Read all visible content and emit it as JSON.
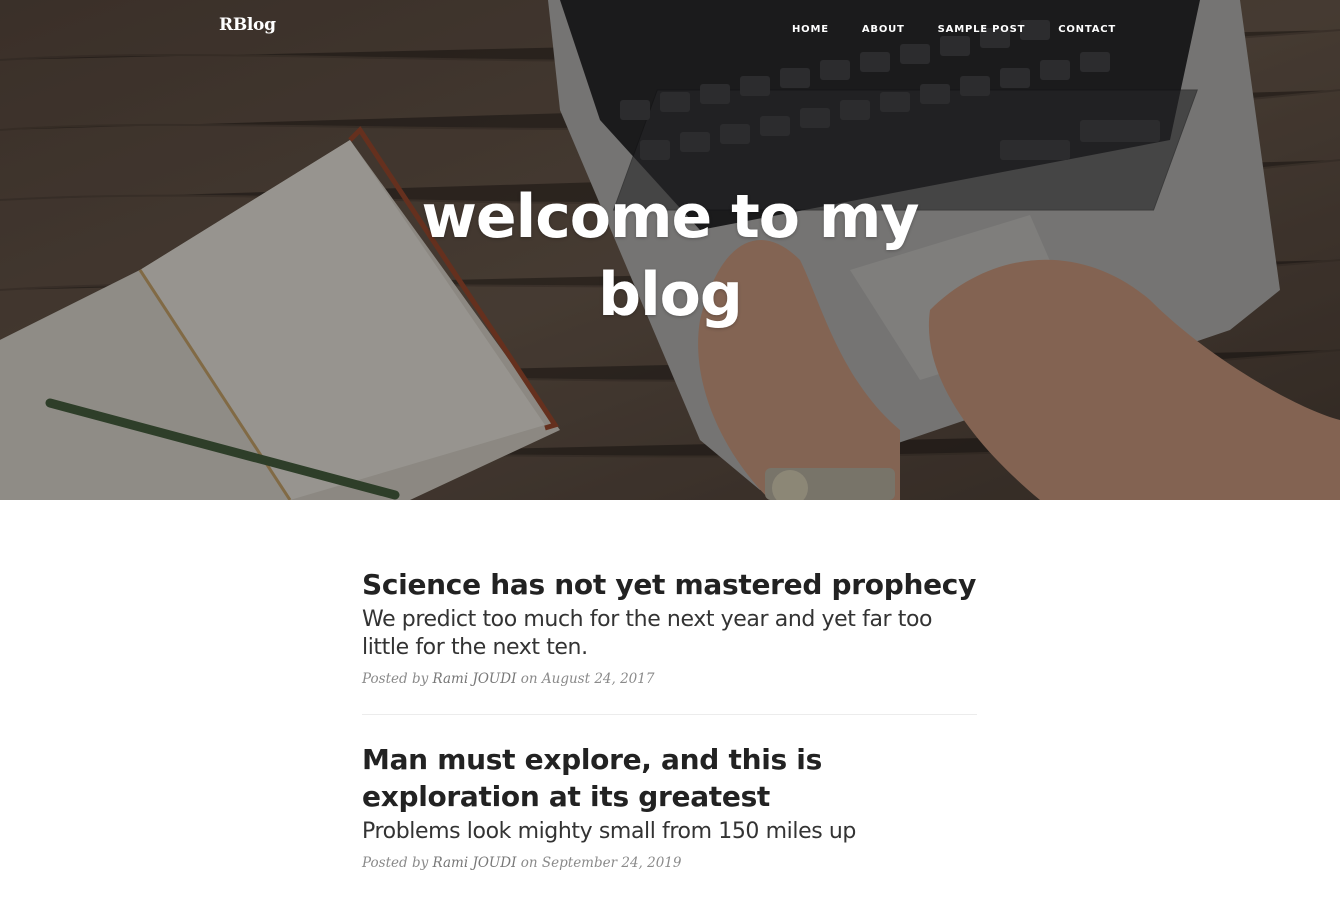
{
  "navbar": {
    "brand": "RBlog",
    "links": [
      "HOME",
      "ABOUT",
      "SAMPLE POST",
      "CONTACT"
    ]
  },
  "hero": {
    "title_line1": "welcome to my",
    "title_line2": "blog"
  },
  "posts": [
    {
      "title": "Science has not yet mastered prophecy",
      "subtitle": "We predict too much for the next year and yet far too little for the next ten.",
      "meta_prefix": "Posted by",
      "author": "Rami JOUDI",
      "meta_on": "on",
      "date": "August 24, 2017"
    },
    {
      "title": "Man must explore, and this is exploration at its greatest",
      "subtitle": "Problems look mighty small from 150 miles up",
      "meta_prefix": "Posted by",
      "author": "Rami JOUDI",
      "meta_on": "on",
      "date": "September 24, 2019"
    }
  ],
  "colors": {
    "overlay": "#000000",
    "text_dark": "#222222",
    "meta": "#8a8a8a"
  }
}
